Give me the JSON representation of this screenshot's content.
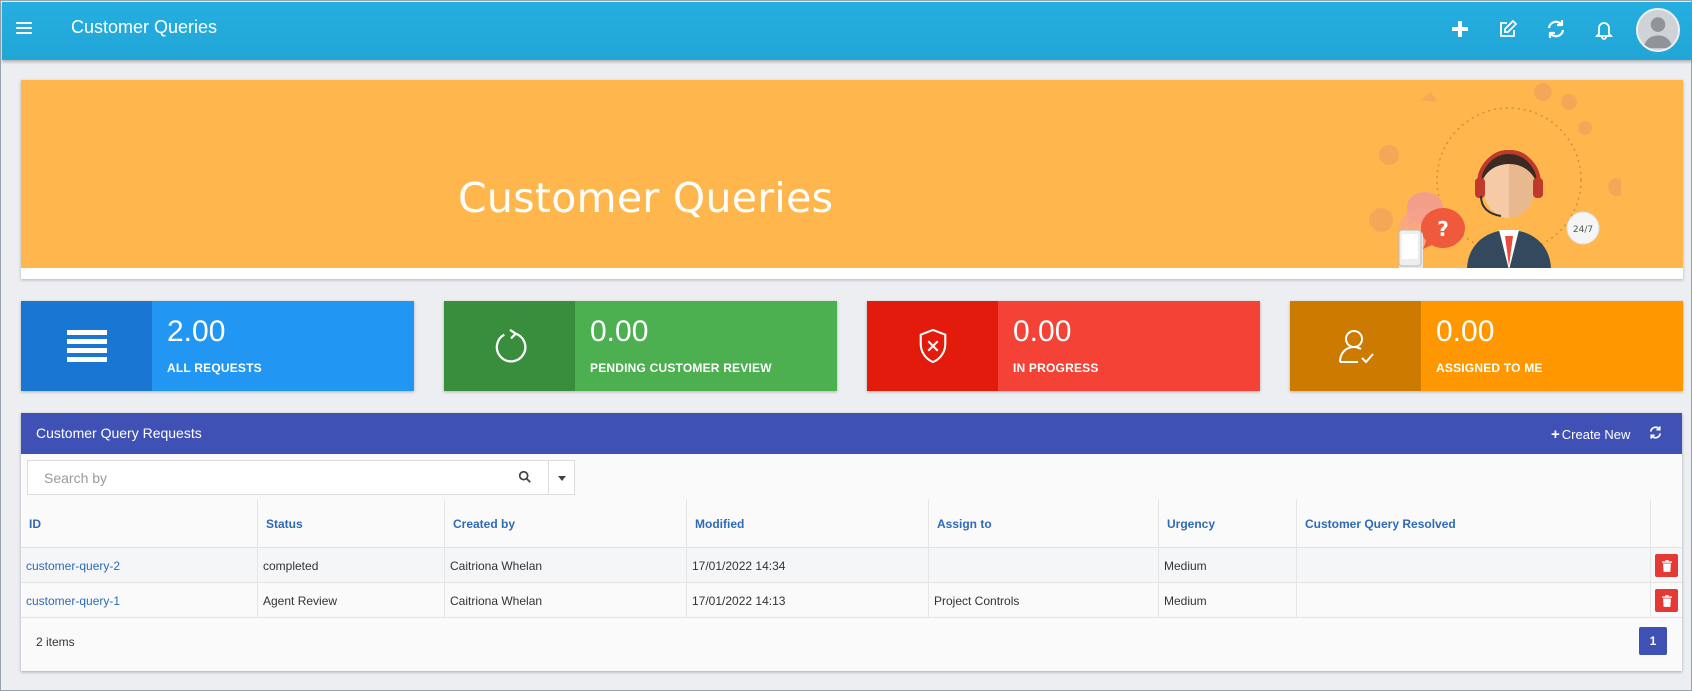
{
  "app": {
    "title": "Customer Queries"
  },
  "header": {
    "actions": [
      "add-icon",
      "edit-icon",
      "refresh-icon",
      "bell-icon",
      "avatar"
    ]
  },
  "banner": {
    "title": "Customer Queries"
  },
  "stats": [
    {
      "value": "2.00",
      "label": "ALL REQUESTS",
      "icon": "list-icon",
      "color": "#2196f3",
      "icon_bg": "#1976d2"
    },
    {
      "value": "0.00",
      "label": "PENDING CUSTOMER REVIEW",
      "icon": "sync-circle-icon",
      "color": "#4caf50",
      "icon_bg": "#388e3c"
    },
    {
      "value": "0.00",
      "label": "IN PROGRESS",
      "icon": "shield-x-icon",
      "color": "#f44336",
      "icon_bg": "#e31b0c"
    },
    {
      "value": "0.00",
      "label": "ASSIGNED TO ME",
      "icon": "user-check-icon",
      "color": "#ff9800",
      "icon_bg": "#cc7a00"
    }
  ],
  "panel": {
    "title": "Customer Query Requests",
    "create_label": "Create New",
    "search_placeholder": "Search by",
    "columns": [
      "ID",
      "Status",
      "Created by",
      "Modified",
      "Assign to",
      "Urgency",
      "Customer Query Resolved"
    ],
    "rows": [
      {
        "id": "customer-query-2",
        "status": "completed",
        "created_by": "Caitriona Whelan",
        "modified": "17/01/2022 14:34",
        "assign_to": "",
        "urgency": "Medium",
        "resolved": ""
      },
      {
        "id": "customer-query-1",
        "status": "Agent Review",
        "created_by": "Caitriona Whelan",
        "modified": "17/01/2022 14:13",
        "assign_to": "Project Controls",
        "urgency": "Medium",
        "resolved": ""
      }
    ],
    "item_count": "2 items",
    "page": "1"
  }
}
